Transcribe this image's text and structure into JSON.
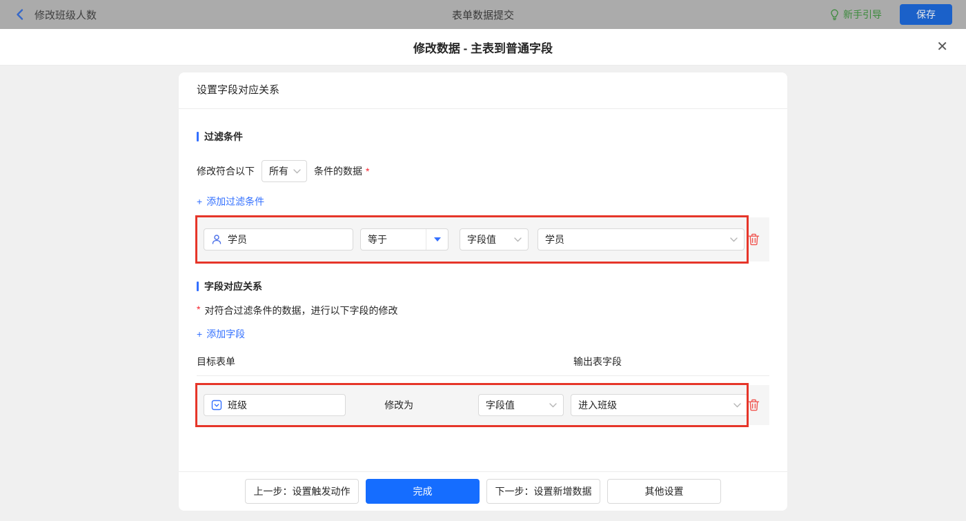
{
  "topbar": {
    "back_label": "修改班级人数",
    "center_title": "表单数据提交",
    "guide_label": "新手引导",
    "save_label": "保存"
  },
  "modal": {
    "title": "修改数据 - 主表到普通字段"
  },
  "icons": {
    "plus": "+",
    "close": "✕"
  },
  "card": {
    "header": "设置字段对应关系",
    "filter_section": {
      "title": "过滤条件",
      "condition_prefix": "修改符合以下",
      "condition_select_value": "所有",
      "condition_suffix": "条件的数据",
      "required_mark": "*",
      "add_link_label": "添加过滤条件",
      "row": {
        "field_value": "学员",
        "operator_value": "等于",
        "type_value": "字段值",
        "value_value": "学员"
      }
    },
    "mapping_section": {
      "title": "字段对应关系",
      "required_mark": "*",
      "description": "对符合过滤条件的数据，进行以下字段的修改",
      "add_link_label": "添加字段",
      "col_target": "目标表单",
      "col_output": "输出表字段",
      "row": {
        "field_value": "班级",
        "modify_label": "修改为",
        "type_value": "字段值",
        "value_value": "进入班级"
      }
    }
  },
  "footer": {
    "prev_label": "上一步：设置触发动作",
    "done_label": "完成",
    "next_label": "下一步：设置新增数据",
    "other_label": "其他设置"
  },
  "colors": {
    "accent_blue": "#156dff",
    "link_blue": "#3370ff",
    "highlight_red": "#e63529",
    "danger_red": "#f0544f",
    "guide_green": "#3c8a3c",
    "topbar_gray": "#ababab",
    "row_gray": "#f5f5f5"
  }
}
